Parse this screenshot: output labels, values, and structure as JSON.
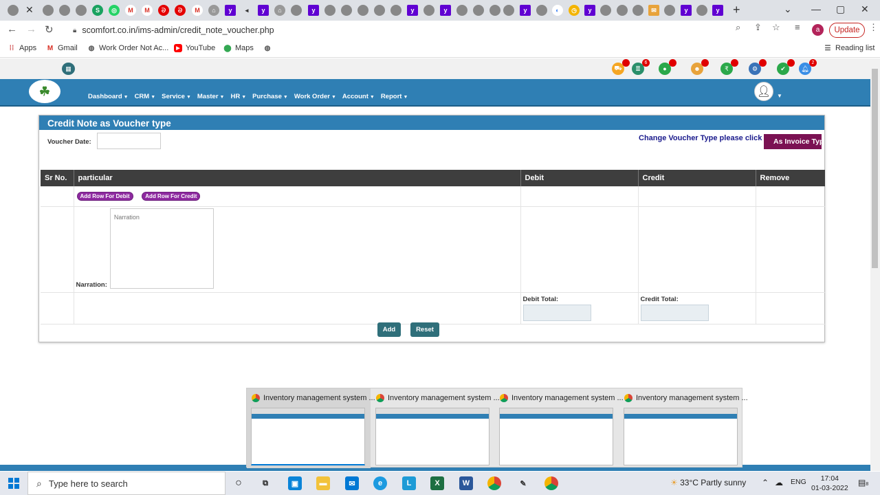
{
  "browser": {
    "url": "scomfort.co.in/ims-admin/credit_note_voucher.php",
    "update_label": "Update",
    "profile_initial": "a",
    "reading_list": "Reading list",
    "bookmarks": [
      {
        "label": "Apps",
        "icon": "apps-grid-icon"
      },
      {
        "label": "Gmail",
        "icon": "gmail-icon"
      },
      {
        "label": "Work Order Not Ac...",
        "icon": "globe-icon"
      },
      {
        "label": "YouTube",
        "icon": "youtube-icon"
      },
      {
        "label": "Maps",
        "icon": "maps-icon"
      }
    ]
  },
  "app": {
    "notification_count_1": "6",
    "notification_count_2": "2",
    "menu": [
      "Dashboard",
      "CRM",
      "Service",
      "Master",
      "HR",
      "Purchase",
      "Work Order",
      "Account",
      "Report"
    ]
  },
  "form": {
    "title": "Credit Note as Voucher type",
    "voucher_date_label": "Voucher Date:",
    "change_type_text": "Change Voucher Type please click :",
    "as_invoice_btn": "As Invoice Type",
    "columns": [
      "Sr No.",
      "particular",
      "Debit",
      "Credit",
      "Remove"
    ],
    "add_debit": "Add Row For Debit",
    "add_credit": "Add Row For Credit",
    "narration_label": "Narration:",
    "narration_placeholder": "Narration",
    "debit_total_label": "Debit Total:",
    "credit_total_label": "Credit Total:",
    "add_btn": "Add",
    "reset_btn": "Reset"
  },
  "thumbnails": [
    {
      "title": "Inventory management system ..."
    },
    {
      "title": "Inventory management system ..."
    },
    {
      "title": "Inventory management system ..."
    },
    {
      "title": "Inventory management system ..."
    }
  ],
  "taskbar": {
    "search_placeholder": "Type here to search",
    "weather": "33°C  Partly sunny",
    "lang": "ENG",
    "time": "17:04",
    "date": "01-03-2022",
    "notif_count": "8"
  },
  "colors": {
    "nav_blue": "#2f7fb4",
    "invoice_btn": "#7b1253",
    "pill_purple": "#8e2aa0",
    "action_btn": "#2f6f7a"
  }
}
